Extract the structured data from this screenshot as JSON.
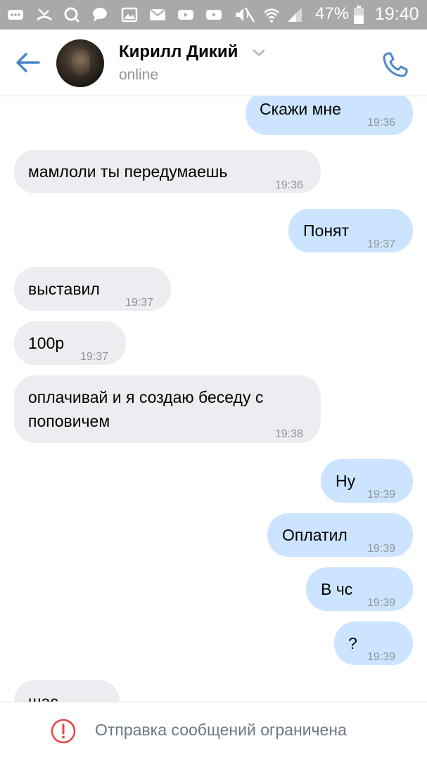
{
  "status_bar": {
    "battery_percent": "47%",
    "time": "19:40",
    "icons": [
      "more-icon",
      "missed-call-icon",
      "search-icon",
      "chat-icon",
      "gallery-icon",
      "mail-icon",
      "youtube-icon",
      "youtube-icon",
      "mute-icon",
      "wifi-icon",
      "signal-icon",
      "battery-icon"
    ]
  },
  "header": {
    "name": "Кирилл Дикий",
    "status": "online"
  },
  "messages": [
    {
      "text": "Скажи мне",
      "time": "19:36",
      "direction": "out"
    },
    {
      "text": "мамлоли ты передумаешь",
      "time": "19:36",
      "direction": "in"
    },
    {
      "text": "Понят",
      "time": "19:37",
      "direction": "out"
    },
    {
      "text": "выставил",
      "time": "19:37",
      "direction": "in"
    },
    {
      "text": "100р",
      "time": "19:37",
      "direction": "in"
    },
    {
      "text_line1": "оплачивай и я создаю беседу с",
      "text_line2": "поповичем",
      "time": "19:38",
      "direction": "in"
    },
    {
      "text": "Ну",
      "time": "19:39",
      "direction": "out"
    },
    {
      "text": "Оплатил",
      "time": "19:39",
      "direction": "out"
    },
    {
      "text": "В чс",
      "time": "19:39",
      "direction": "out"
    },
    {
      "text": "?",
      "time": "19:39",
      "direction": "out"
    },
    {
      "text": "шас",
      "direction": "in"
    }
  ],
  "footer": {
    "notice": "Отправка сообщений ограничена"
  },
  "colors": {
    "accent": "#4986cc",
    "outgoing_bubble": "#cce4ff",
    "incoming_bubble": "#ebedf0",
    "warning": "#e64646"
  }
}
